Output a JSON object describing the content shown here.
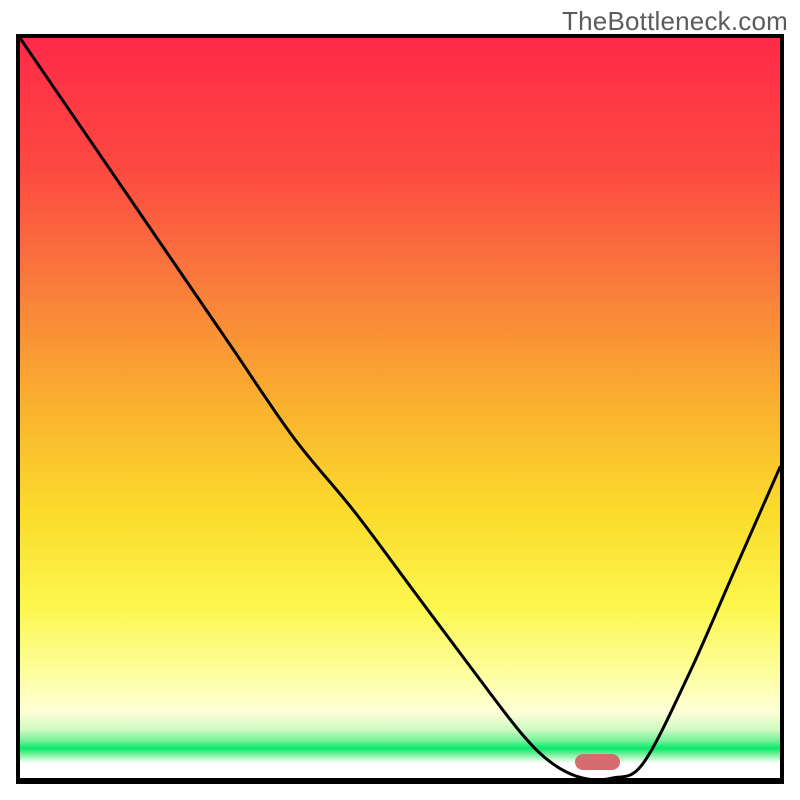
{
  "watermark": "TheBottleneck.com",
  "chart_data": {
    "type": "line",
    "title": "",
    "xlabel": "",
    "ylabel": "",
    "xlim": [
      0,
      100
    ],
    "ylim": [
      0,
      100
    ],
    "x": [
      0,
      8,
      16,
      24,
      28,
      36,
      44,
      52,
      60,
      66,
      70,
      74,
      78,
      82,
      88,
      94,
      100
    ],
    "values": [
      100,
      88,
      76,
      64,
      58,
      46,
      36,
      25,
      14,
      6,
      2,
      0,
      0,
      2,
      14,
      28,
      42
    ],
    "marker": {
      "x_center": 76,
      "y": 0,
      "width": 6,
      "color": "#d66b6f"
    },
    "background_gradient": {
      "top": "#fe2a48",
      "mid_upper": "#f98e3a",
      "mid": "#fbdb2f",
      "mid_lower": "#fdfe8b",
      "green_band": "#06e969",
      "bottom": "#ffffff"
    },
    "curve_color": "#000000"
  }
}
